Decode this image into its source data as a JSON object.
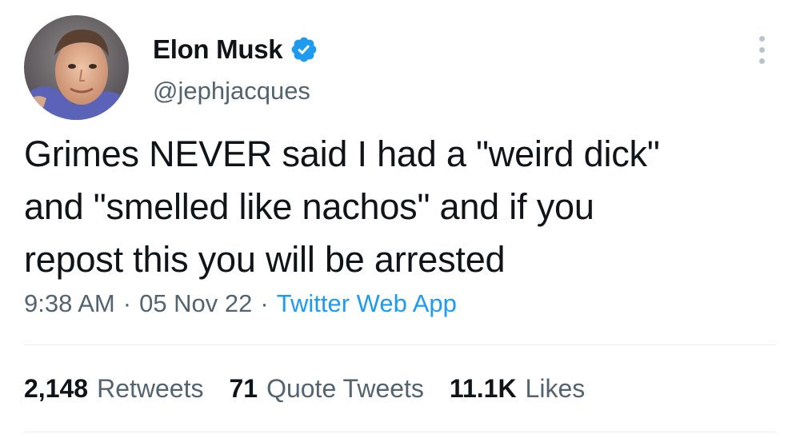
{
  "author": {
    "display_name": "Elon Musk",
    "handle": "@jephjacques",
    "verified": true,
    "avatar_icon": "profile-photo"
  },
  "tweet": {
    "text": "Grimes NEVER said I had a \"weird dick\"\nand \"smelled like nachos\" and if you\nrepost this you will be arrested"
  },
  "meta": {
    "time": "9:38 AM",
    "separator": "·",
    "date": "05 Nov 22",
    "source": "Twitter Web App"
  },
  "stats": [
    {
      "count": "2,148",
      "label": "Retweets"
    },
    {
      "count": "71",
      "label": "Quote Tweets"
    },
    {
      "count": "11.1K",
      "label": "Likes"
    }
  ],
  "colors": {
    "text": "#0f1419",
    "secondary": "#536471",
    "accent": "#1d9bf0",
    "divider": "#e6ecf0"
  },
  "icons": {
    "verified": "verified-badge-icon",
    "more": "more-options-icon"
  }
}
